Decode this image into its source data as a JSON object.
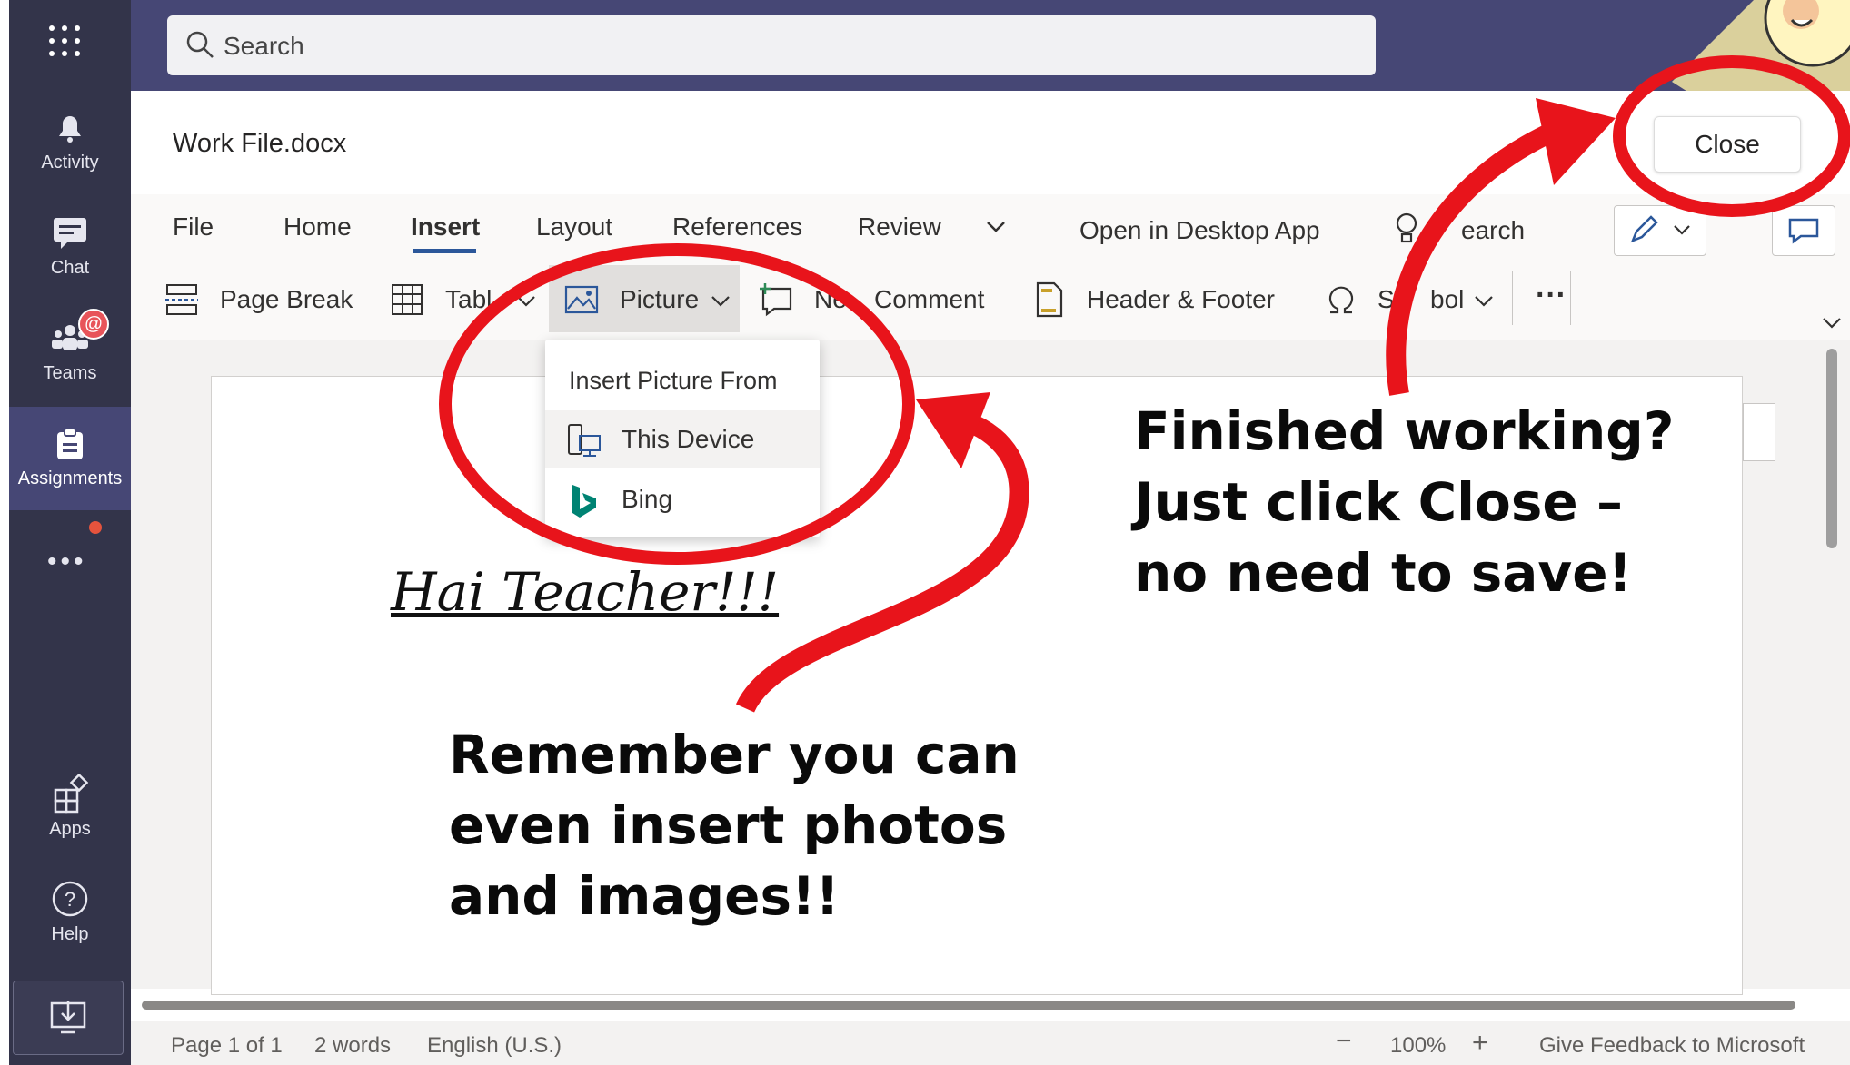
{
  "topbar": {
    "search_placeholder": "Search"
  },
  "rail": {
    "items": [
      {
        "label": "Activity",
        "icon": "bell-icon"
      },
      {
        "label": "Chat",
        "icon": "chat-icon"
      },
      {
        "label": "Teams",
        "icon": "teams-icon",
        "badge": "@"
      },
      {
        "label": "Assignments",
        "icon": "assignments-icon",
        "active": true
      },
      {
        "label": "Apps",
        "icon": "apps-icon"
      },
      {
        "label": "Help",
        "icon": "help-icon"
      }
    ]
  },
  "document": {
    "title": "Work File.docx",
    "close_label": "Close",
    "body_text": "Hai Teacher!!!"
  },
  "ribbon": {
    "tabs": [
      "File",
      "Home",
      "Insert",
      "Layout",
      "References",
      "Review"
    ],
    "active_tab": "Insert",
    "open_desktop": "Open in Desktop App",
    "search_label": "earch",
    "tools": {
      "page_break": "Page Break",
      "table": "Tabl",
      "picture": "Picture",
      "new_comment_a": "Ne",
      "new_comment_b": "Comment",
      "header_footer": "Header & Footer",
      "symbol_a": "Sy",
      "symbol_b": "bol",
      "more": "···"
    }
  },
  "dropdown": {
    "heading": "Insert Picture From",
    "items": [
      {
        "label": "This Device",
        "icon": "device-icon"
      },
      {
        "label": "Bing",
        "icon": "bing-icon"
      }
    ]
  },
  "status": {
    "page": "Page 1 of 1",
    "words": "2 words",
    "language": "English (U.S.)",
    "zoom": "100%",
    "zoom_out": "−",
    "zoom_in": "+",
    "feedback": "Give Feedback to Microsoft"
  },
  "annotations": {
    "close_note": "Finished working?\nJust click Close –\nno need to save!",
    "picture_note": "Remember you can\neven insert photos\nand images!!"
  },
  "colors": {
    "rail": "#33344a",
    "topbar": "#464775",
    "annotation": "#e8141b",
    "accent": "#2b579a"
  }
}
